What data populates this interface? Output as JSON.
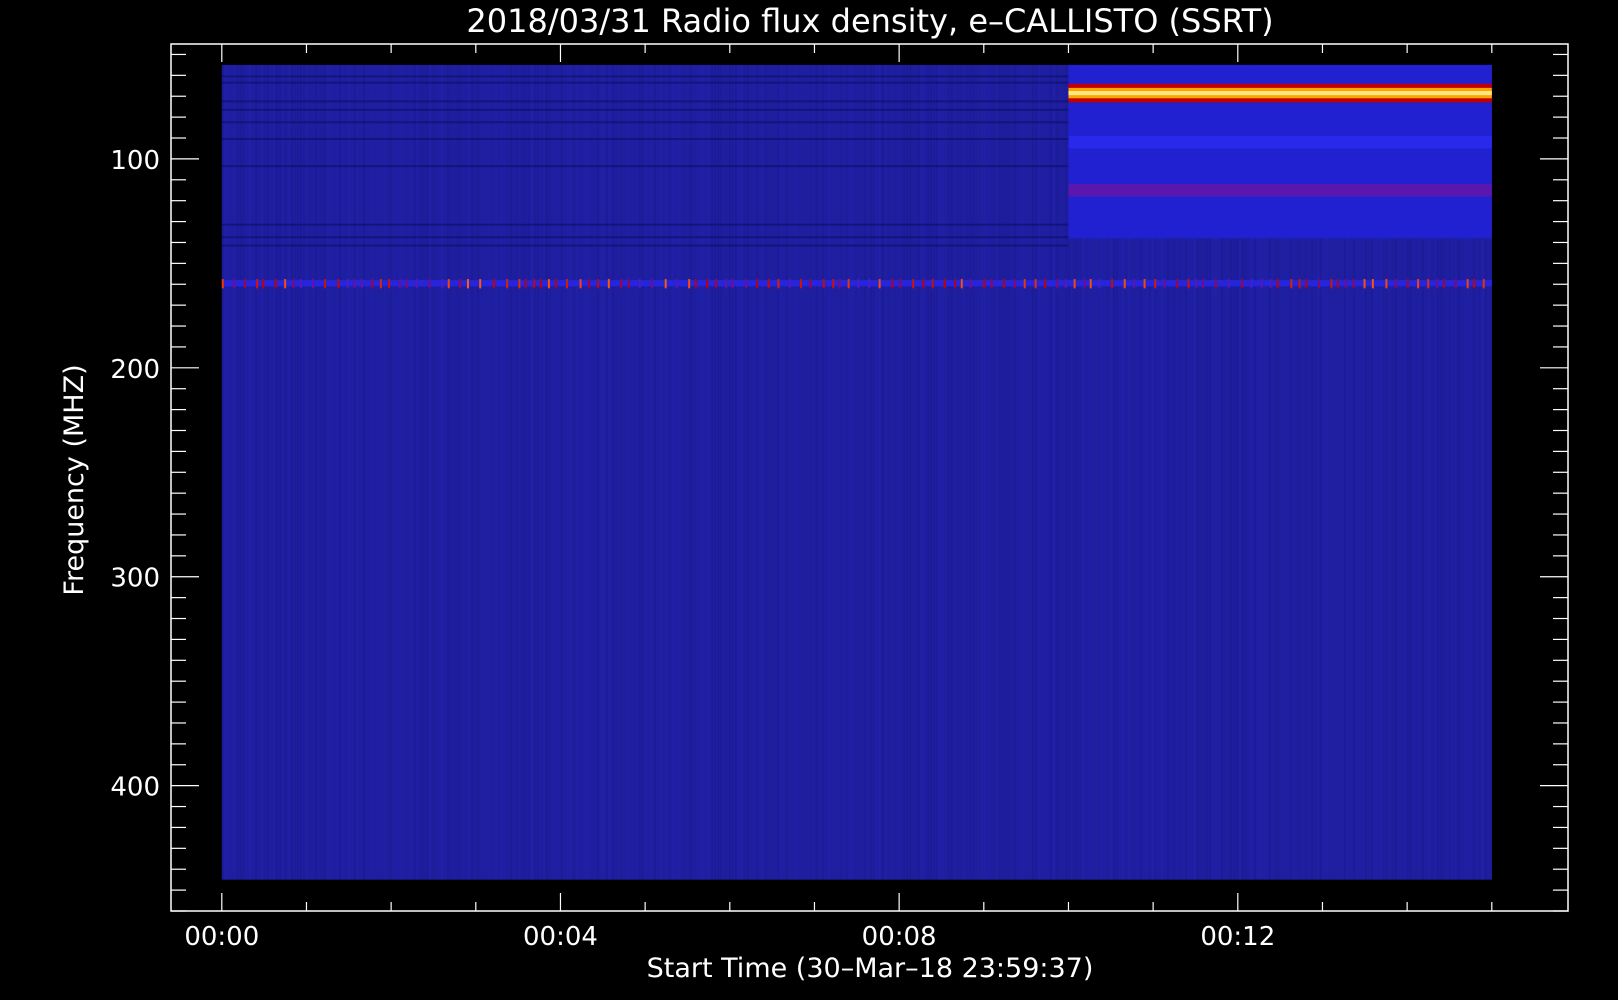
{
  "chart_data": {
    "type": "heatmap",
    "title": "2018/03/31  Radio flux density, e–CALLISTO (SSRT)",
    "xlabel": "Start Time (30–Mar–18 23:59:37)",
    "ylabel": "Frequency (MHZ)",
    "x_unit": "minutes",
    "xlim": [
      -0.6,
      15.9
    ],
    "ylim": [
      45,
      460
    ],
    "y_inverted": true,
    "data_time_range": [
      0,
      15
    ],
    "data_freq_range": [
      55,
      445
    ],
    "x_ticks": [
      {
        "value": 0,
        "label": "00:00"
      },
      {
        "value": 4,
        "label": "00:04"
      },
      {
        "value": 8,
        "label": "00:08"
      },
      {
        "value": 12,
        "label": "00:12"
      }
    ],
    "x_minor_step": 1,
    "y_ticks": [
      {
        "value": 100,
        "label": "100"
      },
      {
        "value": 200,
        "label": "200"
      },
      {
        "value": 300,
        "label": "300"
      },
      {
        "value": 400,
        "label": "400"
      }
    ],
    "y_minor_step": 10,
    "background_color": "#1f1fa0",
    "colormap": [
      "#000030",
      "#1818a0",
      "#1e1ec8",
      "#2a2af0",
      "#7a0a80",
      "#c00000",
      "#ff5000",
      "#ffb000",
      "#ffffc0"
    ],
    "features": [
      {
        "kind": "band",
        "t0": 10.0,
        "t1": 15.0,
        "f0": 55,
        "f1": 138,
        "intensity": 0.28
      },
      {
        "kind": "band",
        "t0": 10.0,
        "t1": 15.0,
        "f0": 64,
        "f1": 73,
        "intensity": 0.62
      },
      {
        "kind": "band",
        "t0": 10.0,
        "t1": 15.0,
        "f0": 66,
        "f1": 71,
        "intensity": 0.86
      },
      {
        "kind": "band",
        "t0": 10.0,
        "t1": 15.0,
        "f0": 67.5,
        "f1": 69.5,
        "intensity": 0.96
      },
      {
        "kind": "band",
        "t0": 10.0,
        "t1": 15.0,
        "f0": 112,
        "f1": 118,
        "intensity": 0.45
      },
      {
        "kind": "band",
        "t0": 10.0,
        "t1": 15.0,
        "f0": 89,
        "f1": 95,
        "intensity": 0.36
      },
      {
        "kind": "band",
        "t0": 0.0,
        "t1": 15.0,
        "f0": 158,
        "f1": 161,
        "intensity": 0.42,
        "speckled": true
      }
    ]
  }
}
